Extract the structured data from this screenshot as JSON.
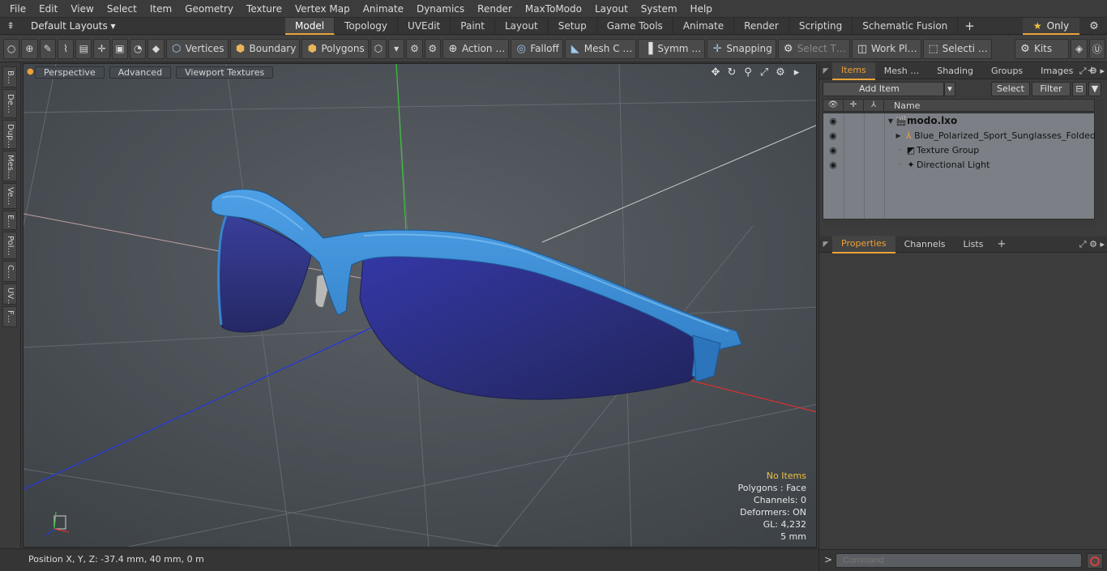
{
  "menu": [
    "File",
    "Edit",
    "View",
    "Select",
    "Item",
    "Geometry",
    "Texture",
    "Vertex Map",
    "Animate",
    "Dynamics",
    "Render",
    "MaxToModo",
    "Layout",
    "System",
    "Help"
  ],
  "layout_selector": "Default Layouts ▾",
  "layout_tabs": [
    "Model",
    "Topology",
    "UVEdit",
    "Paint",
    "Layout",
    "Setup",
    "Game Tools",
    "Animate",
    "Render",
    "Scripting",
    "Schematic Fusion"
  ],
  "only_label": "Only",
  "toolbar": {
    "vertices": "Vertices",
    "boundary": "Boundary",
    "polygons": "Polygons",
    "action": "Action …",
    "falloff": "Falloff",
    "mesh": "Mesh C …",
    "symmetry": "Symm …",
    "snapping": "Snapping",
    "select_t": "Select T…",
    "work_plane": "Work Pl…",
    "selection": "Selecti …",
    "kits": "Kits"
  },
  "left_tabs": [
    "B…",
    "De…",
    "Dup…",
    "Mes…",
    "Ve…",
    "E…",
    "Pol…",
    "C…",
    "UV…",
    "F…"
  ],
  "viewport": {
    "tabs": [
      "Perspective",
      "Advanced",
      "Viewport Textures"
    ],
    "info": {
      "selection": "No Items",
      "polygons": "Polygons : Face",
      "channels": "Channels: 0",
      "deformers": "Deformers: ON",
      "gl": "GL: 4,232",
      "grid": "5 mm"
    }
  },
  "status": "Position X, Y, Z:   -37.4 mm, 40 mm, 0 m",
  "items_panel": {
    "tabs": [
      "Items",
      "Mesh …",
      "Shading",
      "Groups",
      "Images"
    ],
    "add_item": "Add Item",
    "select": "Select",
    "filter": "Filter",
    "column_name": "Name",
    "rows": [
      {
        "label": "modo.lxo"
      },
      {
        "label": "Blue_Polarized_Sport_Sunglasses_Folded"
      },
      {
        "label": "Texture Group"
      },
      {
        "label": "Directional Light"
      }
    ]
  },
  "props_panel": {
    "tabs": [
      "Properties",
      "Channels",
      "Lists"
    ]
  },
  "command_placeholder": "Command",
  "colors": {
    "accent": "#e9a33a",
    "frame_blue": "#3f8fd6",
    "lens": "#2b2f7a"
  }
}
